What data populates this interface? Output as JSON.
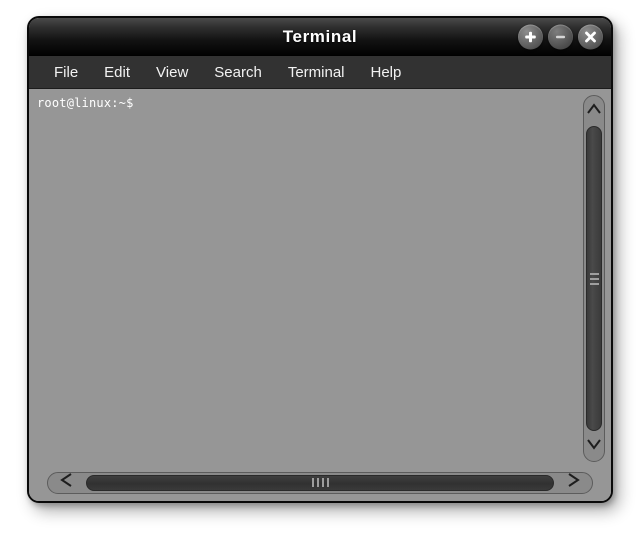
{
  "window": {
    "title": "Terminal",
    "colors": {
      "titlebar_top": "#4a4a4a",
      "titlebar_bottom": "#000000",
      "menubar": "#323232",
      "terminal_background": "#969696",
      "terminal_text": "#ffffff",
      "scrollbar_trough": "#8a8a8a",
      "scrollbar_thumb": "#3a3a3a",
      "window_border": "#0a0a0a",
      "page_background": "#ffffff"
    },
    "buttons": [
      {
        "name": "maximize",
        "glyph": "+",
        "icon": "plus-icon"
      },
      {
        "name": "minimize",
        "glyph": "−",
        "icon": "minus-icon"
      },
      {
        "name": "close",
        "glyph": "×",
        "icon": "close-icon"
      }
    ]
  },
  "menubar": {
    "items": [
      {
        "label": "File"
      },
      {
        "label": "Edit"
      },
      {
        "label": "View"
      },
      {
        "label": "Search"
      },
      {
        "label": "Terminal"
      },
      {
        "label": "Help"
      }
    ]
  },
  "terminal": {
    "lines": [
      "root@linux:~$"
    ],
    "prompt": "root@linux:~$",
    "user": "root",
    "host": "linux",
    "cwd": "~",
    "symbol": "$"
  },
  "scrollbars": {
    "vertical": {
      "up_arrow_icon": "chevron-up-icon",
      "down_arrow_icon": "chevron-down-icon",
      "grip_line_count": 3
    },
    "horizontal": {
      "left_arrow_icon": "chevron-left-icon",
      "right_arrow_icon": "chevron-right-icon",
      "grip_line_count": 4
    }
  }
}
